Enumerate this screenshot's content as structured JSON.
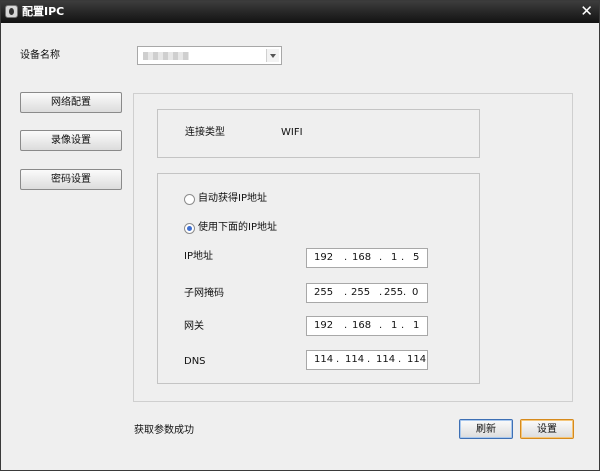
{
  "window": {
    "title": "配置IPC",
    "close_glyph": "✕"
  },
  "device": {
    "label": "设备名称"
  },
  "sidebar": {
    "buttons": [
      {
        "label": "网络配置"
      },
      {
        "label": "录像设置"
      },
      {
        "label": "密码设置"
      }
    ]
  },
  "connection": {
    "label": "连接类型",
    "value": "WIFI"
  },
  "ip_mode": {
    "auto_label": "自动获得IP地址",
    "manual_label": "使用下面的IP地址",
    "selected": "manual"
  },
  "fields": [
    {
      "label": "IP地址",
      "octets": [
        "192",
        "168",
        "1",
        "5"
      ]
    },
    {
      "label": "子网掩码",
      "octets": [
        "255",
        "255",
        "255",
        "0"
      ]
    },
    {
      "label": "网关",
      "octets": [
        "192",
        "168",
        "1",
        "1"
      ]
    },
    {
      "label": "DNS",
      "octets": [
        "114",
        "114",
        "114",
        "114"
      ]
    }
  ],
  "status": {
    "text": "获取参数成功"
  },
  "actions": {
    "refresh_label": "刷新",
    "set_label": "设置"
  },
  "colors": {
    "refresh_border": "#3d6fb4",
    "set_border": "#d68a1c",
    "radio_dot": "#3f6fd0"
  }
}
